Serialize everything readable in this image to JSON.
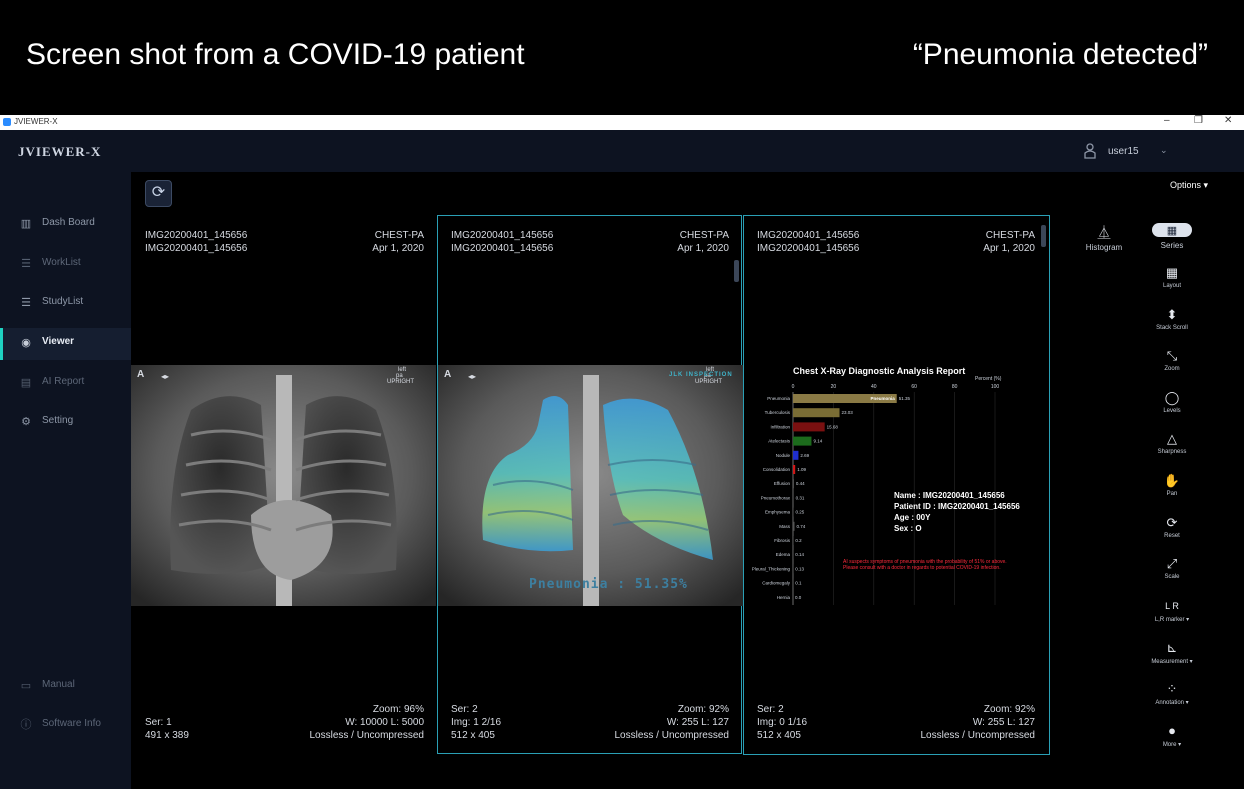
{
  "banner": {
    "left_text": "Screen shot from a COVID-19 patient",
    "right_text": "“Pneumonia detected”"
  },
  "window": {
    "title": "JVIEWER-X",
    "minimize": "–",
    "restore": "❐",
    "close": "✕"
  },
  "app": {
    "brand": "JVIEWER-X",
    "user": "user15"
  },
  "sidebar": {
    "items": [
      {
        "label": "Dash Board",
        "icon": "chart-icon"
      },
      {
        "label": "WorkList",
        "icon": "list-icon"
      },
      {
        "label": "StudyList",
        "icon": "list-icon"
      },
      {
        "label": "Viewer",
        "icon": "eye-icon"
      },
      {
        "label": "AI Report",
        "icon": "report-icon"
      },
      {
        "label": "Setting",
        "icon": "gear-icon"
      }
    ],
    "bottom": [
      {
        "label": "Manual",
        "icon": "book-icon"
      },
      {
        "label": "Software Info",
        "icon": "info-icon"
      }
    ]
  },
  "toolbar": {
    "options_label": "Options"
  },
  "viewports": [
    {
      "id1": "IMG20200401_145656",
      "id2": "IMG20200401_145656",
      "modality": "CHEST-PA",
      "date": "Apr 1, 2020",
      "orient": "A",
      "marker_left": "left",
      "marker_pa": "pa",
      "marker_upright": "UPRIGHT",
      "ser": "Ser: 1",
      "img": "",
      "size": "491 x 389",
      "zoom": "Zoom: 96%",
      "wl": "W: 10000 L: 5000",
      "comp": "Lossless / Uncompressed"
    },
    {
      "id1": "IMG20200401_145656",
      "id2": "IMG20200401_145656",
      "modality": "CHEST-PA",
      "date": "Apr 1, 2020",
      "orient": "A",
      "marker_left": "left",
      "marker_pa": "pa",
      "marker_upright": "UPRIGHT",
      "overlay_tag": "JLK INSPECTION",
      "finding": "Pneumonia : 51.35%",
      "ser": "Ser: 2",
      "img": "Img: 1 2/16",
      "size": "512 x 405",
      "zoom": "Zoom: 92%",
      "wl": "W: 255 L: 127",
      "comp": "Lossless / Uncompressed"
    },
    {
      "id1": "IMG20200401_145656",
      "id2": "IMG20200401_145656",
      "modality": "CHEST-PA",
      "date": "Apr 1, 2020",
      "ser": "Ser: 2",
      "img": "Img: 0 1/16",
      "size": "512 x 405",
      "zoom": "Zoom: 92%",
      "wl": "W: 255 L: 127",
      "comp": "Lossless / Uncompressed"
    }
  ],
  "report": {
    "title": "Chest X-Ray Diagnostic Analysis Report",
    "axis_label": "Percent (%)",
    "ticks": [
      "0",
      "20",
      "40",
      "60",
      "80",
      "100"
    ],
    "name_line": "Name : IMG20200401_145656",
    "pid_line": "Patient ID : IMG20200401_145656",
    "age_line": "Age : 00Y",
    "sex_line": "Sex : O",
    "warning_1": "AI suspects symptoms of pneumonia with the probability of 51% or above.",
    "warning_2": "Please consult with a doctor in regards to potential COVID-19 infection."
  },
  "chart_data": {
    "type": "bar",
    "title": "Chest X-Ray Diagnostic Analysis Report",
    "xlabel": "Percent (%)",
    "xlim": [
      0,
      100
    ],
    "categories": [
      "Pneumonia",
      "Tuberculosis",
      "Infiltration",
      "Atelectasis",
      "Nodule",
      "Consolidation",
      "Effusion",
      "Pneumothorax",
      "Emphysema",
      "Mass",
      "Fibrosis",
      "Edema",
      "Pleural_Thickening",
      "Cardiomegaly",
      "Hernia"
    ],
    "values": [
      51.35,
      23.03,
      15.68,
      9.14,
      2.69,
      1.09,
      0.44,
      0.31,
      0.25,
      0.74,
      0.2,
      0.14,
      0.13,
      0.1,
      0.0
    ],
    "labels": [
      "51.35",
      "23.03",
      "15.68",
      "9.14",
      "2.69",
      "1.09",
      "0.44",
      "0.31",
      "0.25",
      "0.74",
      "0.2",
      "0.14",
      "0.13",
      "0.1",
      "0.0"
    ],
    "highlight_label": "Pneumonia",
    "colors": [
      "#8a7a45",
      "#7a6d35",
      "#7a1010",
      "#1c6b1c",
      "#1f2fd0",
      "#d01818",
      "#555",
      "#555",
      "#555",
      "#555",
      "#555",
      "#555",
      "#555",
      "#555",
      "#555"
    ]
  },
  "tools": {
    "histogram": "Histogram",
    "items": [
      {
        "label": "Series",
        "icon": "series-icon"
      },
      {
        "label": "Layout",
        "icon": "grid-icon"
      },
      {
        "label": "Stack Scroll",
        "icon": "stack-scroll-icon"
      },
      {
        "label": "Zoom",
        "icon": "zoom-icon"
      },
      {
        "label": "Levels",
        "icon": "levels-icon"
      },
      {
        "label": "Sharpness",
        "icon": "sharpness-icon"
      },
      {
        "label": "Pan",
        "icon": "hand-icon"
      },
      {
        "label": "Reset",
        "icon": "reset-icon"
      },
      {
        "label": "Scale",
        "icon": "scale-icon"
      },
      {
        "label": "L,R marker ▾",
        "icon": "lr-marker-icon"
      },
      {
        "label": "Measurement ▾",
        "icon": "ruler-icon"
      },
      {
        "label": "Annotation ▾",
        "icon": "annotation-icon"
      },
      {
        "label": "More ▾",
        "icon": "more-icon"
      }
    ],
    "lr_glyph": "L R"
  }
}
